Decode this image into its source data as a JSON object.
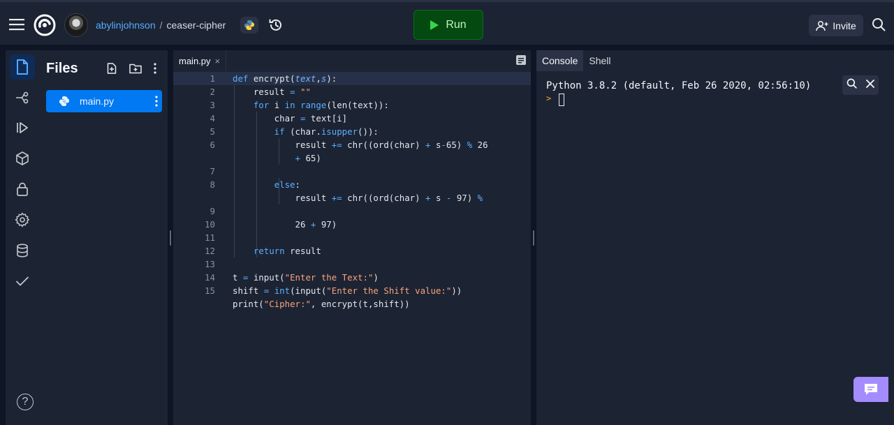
{
  "topbar": {
    "username": "abylinjohnson",
    "separator": "/",
    "repl_name": "ceaser-cipher",
    "run_label": "Run",
    "invite_label": "Invite"
  },
  "files_panel": {
    "title": "Files",
    "items": [
      {
        "label": "main.py"
      }
    ]
  },
  "editor": {
    "tab_label": "main.py",
    "tab_close": "×",
    "line_numbers": [
      "1",
      "2",
      "3",
      "4",
      "5",
      "6",
      "7",
      "8",
      "9",
      "10",
      "11",
      "12",
      "13",
      "14",
      "15"
    ]
  },
  "console": {
    "tabs": [
      {
        "label": "Console"
      },
      {
        "label": "Shell"
      }
    ],
    "output": "Python 3.8.2 (default, Feb 26 2020, 02:56:10)",
    "prompt": ">"
  },
  "help_label": "?",
  "colors": {
    "run_bg": "#044a10",
    "run_icon": "#3ad34f",
    "accent": "#0079f2",
    "username": "#57abff",
    "feedback": "#a48cff"
  }
}
